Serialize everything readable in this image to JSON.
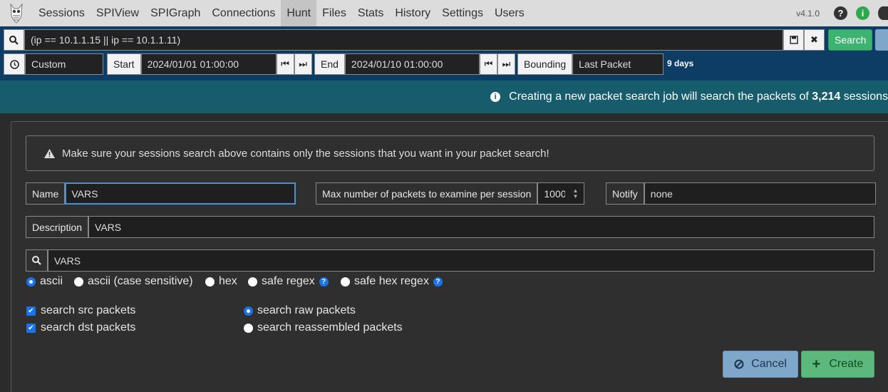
{
  "nav": {
    "items": [
      "Sessions",
      "SPIView",
      "SPIGraph",
      "Connections",
      "Hunt",
      "Files",
      "Stats",
      "History",
      "Settings",
      "Users"
    ],
    "active": "Hunt",
    "version": "v4.1.0",
    "icons": [
      "help-icon",
      "info-icon",
      "settings-icon"
    ]
  },
  "search": {
    "query": "(ip == 10.1.1.15 || ip == 10.1.1.11)",
    "search_button": "Search"
  },
  "time": {
    "range": "Custom",
    "start_label": "Start",
    "start_value": "2024/01/01 01:00:00",
    "end_label": "End",
    "end_value": "2024/01/10 01:00:00",
    "bounding_label": "Bounding",
    "bounding_value": "Last Packet",
    "duration": "9 days"
  },
  "banner": {
    "text_prefix": "Creating a new packet search job will search the packets of ",
    "count": "3,214",
    "text_suffix": " sessions"
  },
  "form": {
    "warning": "Make sure your sessions search above contains only the sessions that you want in your packet search!",
    "name_label": "Name",
    "name_value": "VARS",
    "max_label": "Max number of packets to examine per session",
    "max_value": "1000",
    "notify_label": "Notify",
    "notify_value": "none",
    "description_label": "Description",
    "description_value": "VARS",
    "search_value": "VARS",
    "search_types": [
      {
        "label": "ascii",
        "checked": true,
        "help": false
      },
      {
        "label": "ascii (case sensitive)",
        "checked": false,
        "help": false
      },
      {
        "label": "hex",
        "checked": false,
        "help": false
      },
      {
        "label": "safe regex",
        "checked": false,
        "help": true
      },
      {
        "label": "safe hex regex",
        "checked": false,
        "help": true
      }
    ],
    "src_packets": "search src packets",
    "dst_packets": "search dst packets",
    "raw_packets": "search raw packets",
    "reassembled_packets": "search reassembled packets",
    "cancel": "Cancel",
    "create": "Create"
  },
  "colors": {
    "navbar": "#dcdcdc",
    "search_area": "#0d3c64",
    "banner": "#175c6c",
    "accent_green": "#3cb371",
    "cancel_blue": "#7fa7c9"
  }
}
